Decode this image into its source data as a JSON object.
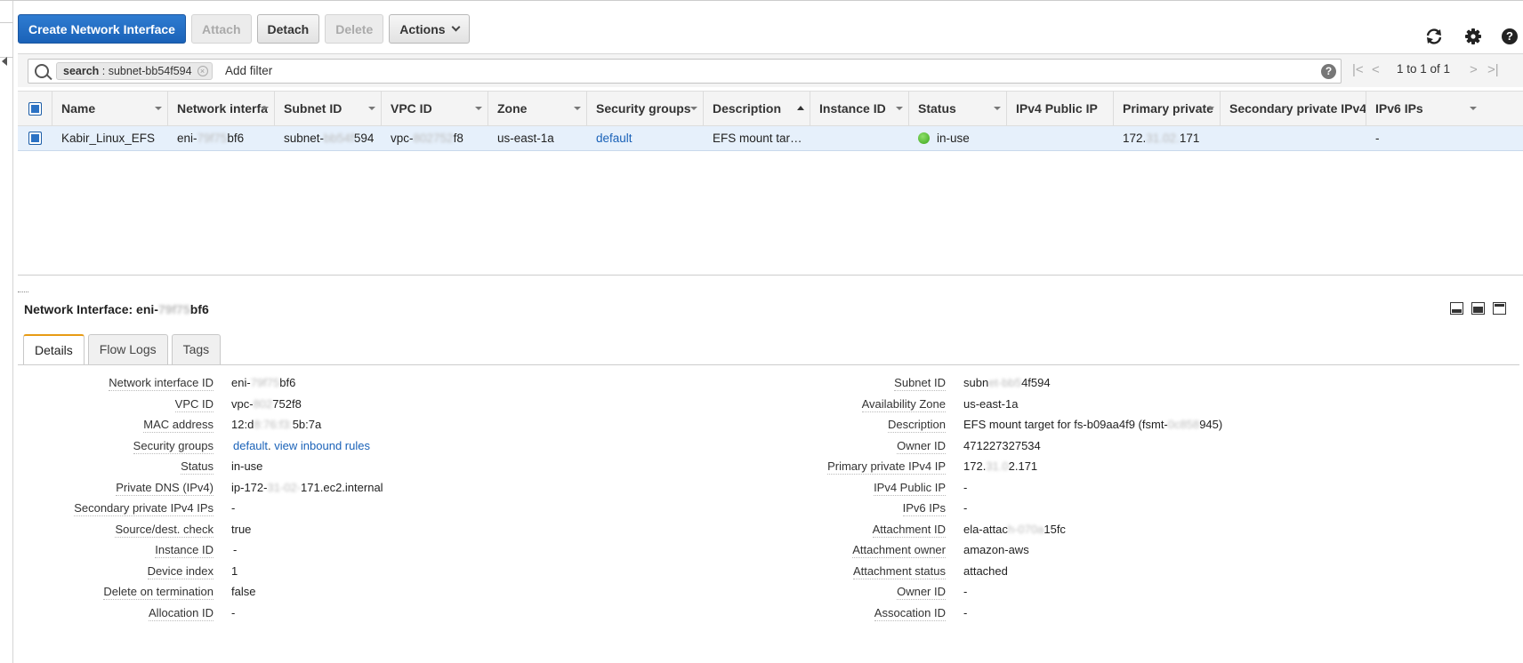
{
  "toolbar": {
    "create": "Create Network Interface",
    "attach": "Attach",
    "detach": "Detach",
    "delete": "Delete",
    "actions": "Actions"
  },
  "filter": {
    "token_key": "search",
    "token_value": " : subnet-bb54f594",
    "add_filter": "Add filter",
    "help": "?",
    "pager_text": "1 to 1 of 1"
  },
  "table": {
    "headers": [
      "Name",
      "Network interfa",
      "Subnet ID",
      "VPC ID",
      "Zone",
      "Security groups",
      "Description",
      "Instance ID",
      "Status",
      "IPv4 Public IP",
      "Primary private",
      "Secondary private IPv4",
      "IPv6 IPs"
    ],
    "row": {
      "name": "Kabir_Linux_EFS",
      "eni_a": "eni-",
      "eni_b": "79f75",
      "eni_c": "bf6",
      "subnet_a": "subnet-",
      "subnet_b": "bb54f",
      "subnet_c": "594",
      "vpc_a": "vpc-",
      "vpc_b": "802752",
      "vpc_c": "f8",
      "zone": "us-east-1a",
      "security_group": "default",
      "description": "EFS mount tar…",
      "instance_id": "",
      "status": "in-use",
      "ipv4_public": "",
      "primary_a": "172.",
      "primary_b": "31.02.",
      "primary_c": "171",
      "secondary": "",
      "ipv6": "-"
    }
  },
  "detail": {
    "title_prefix": "Network Interface: eni-",
    "title_blur": "79f75",
    "title_suffix": "bf6",
    "tabs": [
      "Details",
      "Flow Logs",
      "Tags"
    ],
    "left": {
      "labels": [
        "Network interface ID",
        "VPC ID",
        "MAC address",
        "Security groups",
        "Status",
        "Private DNS (IPv4)",
        "Secondary private IPv4 IPs",
        "Source/dest. check",
        "Instance ID",
        "Device index",
        "Delete on termination",
        "Allocation ID"
      ],
      "eni_a": "eni-",
      "eni_b": "79f75",
      "eni_c": "bf6",
      "vpc_a": "vpc-",
      "vpc_b": "802",
      "vpc_c": "752f8",
      "mac_a": "12:d",
      "mac_b": "8:76:f3:",
      "mac_c": "5b:7a",
      "sg_link": "default",
      "sg_sep": ". ",
      "sg_rules": "view inbound rules",
      "status": "in-use",
      "dns_a": "ip-172-",
      "dns_b": "31-02-",
      "dns_c": "171.ec2.internal",
      "secondary": "-",
      "source_dest": "true",
      "instance_id": "-",
      "device_index": "1",
      "delete_on_termination": "false",
      "allocation_id": "-"
    },
    "right": {
      "labels": [
        "Subnet ID",
        "Availability Zone",
        "Description",
        "Owner ID",
        "Primary private IPv4 IP",
        "IPv4 Public IP",
        "IPv6 IPs",
        "Attachment ID",
        "Attachment owner",
        "Attachment status",
        "Owner ID",
        "Assocation ID"
      ],
      "subnet_a": "subn",
      "subnet_b": "et-bb5",
      "subnet_c": "4f594",
      "zone": "us-east-1a",
      "desc_a": "EFS mount target for fs-b09aa4f9 (fsmt-",
      "desc_b": "0c858",
      "desc_c": "945)",
      "owner_id": "471227327534",
      "primary_a": "172.",
      "primary_b": "31.0",
      "primary_c": "2.171",
      "ipv4_public": "-",
      "ipv6": "-",
      "attach_a": "ela-attac",
      "attach_b": "h-070a",
      "attach_c": "15fc",
      "attachment_owner": "amazon-aws",
      "attachment_status": "attached",
      "owner_id_2": "-",
      "association_id": "-"
    }
  }
}
